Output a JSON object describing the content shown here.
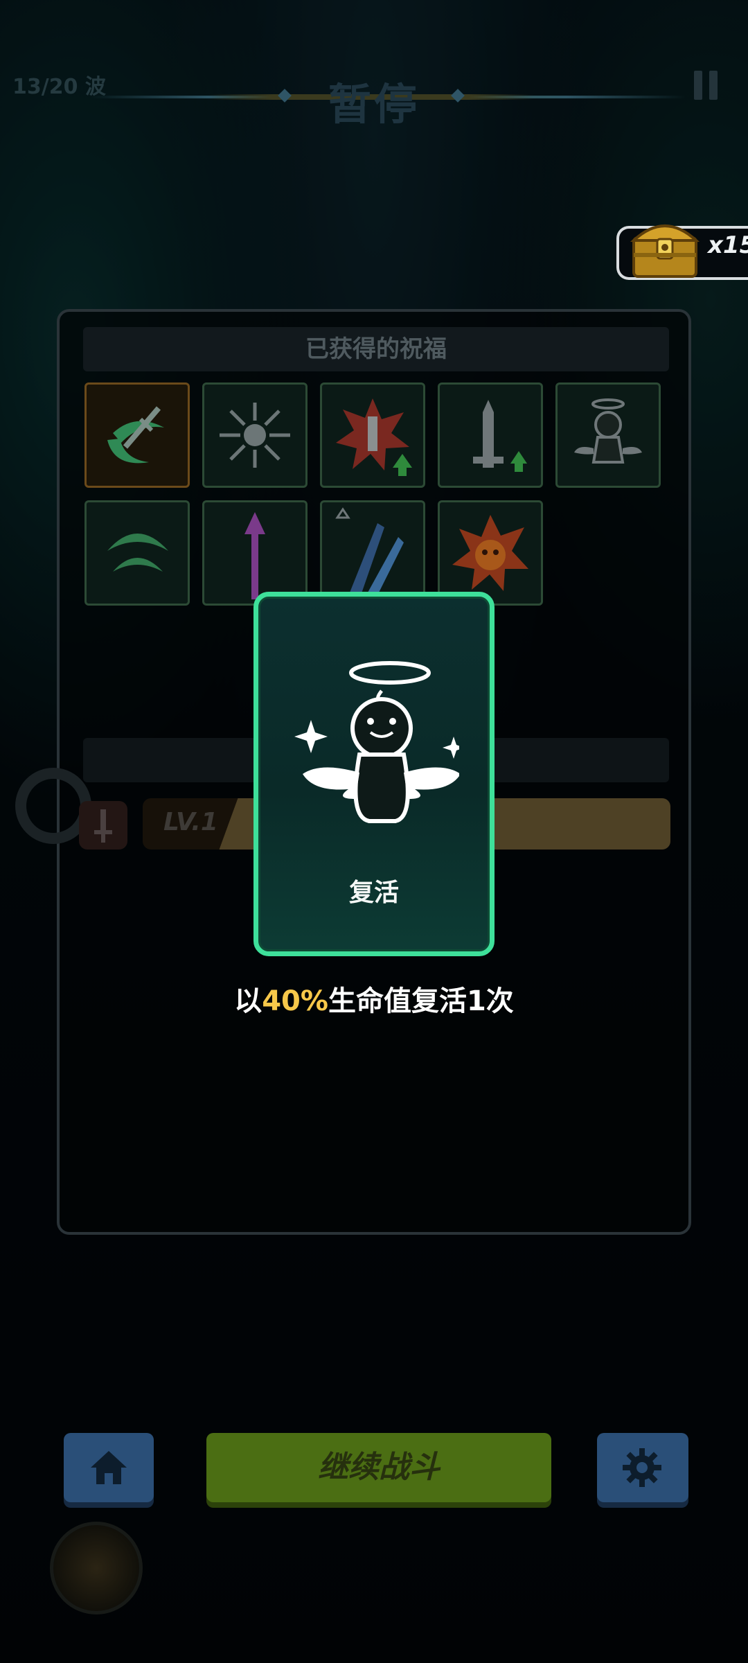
{
  "header": {
    "wave": "13/20 波",
    "title": "暂停"
  },
  "chest": {
    "count": "x15",
    "icon": "treasure-chest-icon"
  },
  "blessings": {
    "section_title": "已获得的祝福",
    "items": [
      {
        "icon": "spinning-sword-icon",
        "selected": true
      },
      {
        "icon": "split-arrows-icon",
        "selected": false
      },
      {
        "icon": "explosion-attack-up-icon",
        "selected": false
      },
      {
        "icon": "atk-sword-up-icon",
        "selected": false
      },
      {
        "icon": "angel-revive-icon",
        "selected": false
      },
      {
        "icon": "green-crescent-icon",
        "selected": false
      },
      {
        "icon": "purple-arrow-icon",
        "selected": false
      },
      {
        "icon": "crystal-shards-icon",
        "selected": false
      },
      {
        "icon": "skull-explosion-icon",
        "selected": false
      }
    ]
  },
  "weapon": {
    "level_label": "LV.1"
  },
  "featured_card": {
    "name": "复活",
    "desc_prefix": "以",
    "desc_highlight": "40%",
    "desc_suffix": "生命值复活1次",
    "accent_color": "#3ee09a",
    "highlight_color": "#f7c84a"
  },
  "buttons": {
    "continue_label": "继续战斗",
    "home_icon": "home-icon",
    "settings_icon": "gear-icon"
  }
}
